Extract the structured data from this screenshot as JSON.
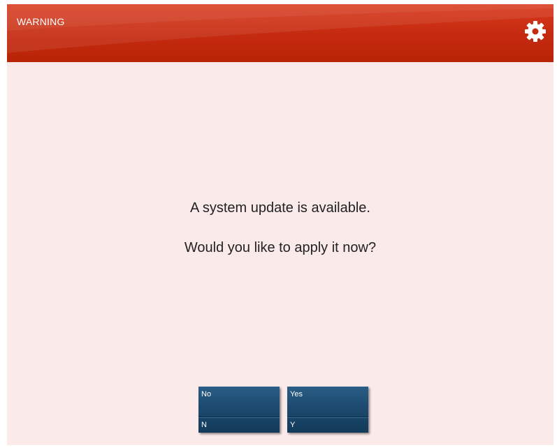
{
  "header": {
    "title": "WARNING",
    "settings_icon": "gear-icon",
    "color": "#c42a10"
  },
  "message": {
    "line1": "A system update is available.",
    "line2": "Would you like to apply it now?"
  },
  "buttons": [
    {
      "label": "No",
      "key": "N"
    },
    {
      "label": "Yes",
      "key": "Y"
    }
  ],
  "colors": {
    "background": "#fbeaea",
    "button": "#1d4a6f",
    "text": "#222222"
  }
}
